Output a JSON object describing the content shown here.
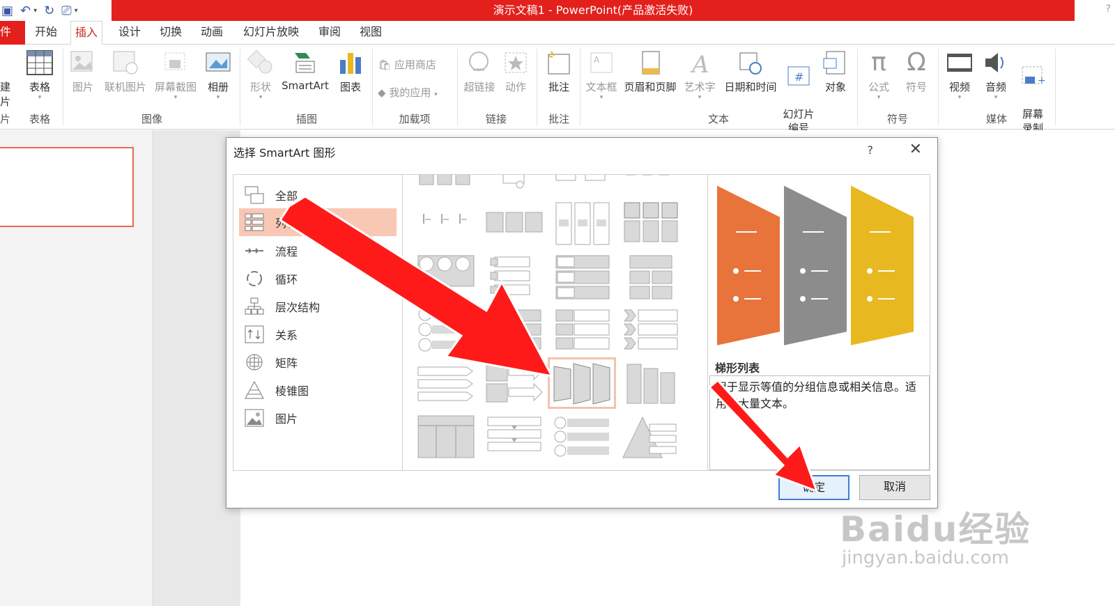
{
  "window": {
    "title": "演示文稿1 -  PowerPoint(产品激活失败)",
    "help": "?"
  },
  "tabs": [
    "件",
    "开始",
    "插入",
    "设计",
    "切换",
    "动画",
    "幻灯片放映",
    "审阅",
    "视图"
  ],
  "ribbon": {
    "partial_left": [
      "建",
      "片",
      "片"
    ],
    "table": {
      "label": "表格",
      "group": "表格"
    },
    "images": {
      "items": [
        "图片",
        "联机图片",
        "屏幕截图",
        "相册"
      ],
      "group": "图像"
    },
    "illustrations": {
      "items": [
        "形状",
        "SmartArt",
        "图表"
      ],
      "group": "插图"
    },
    "addins": {
      "items": [
        "应用商店",
        "我的应用"
      ],
      "group": "加载项"
    },
    "links": {
      "items": [
        "超链接",
        "动作"
      ],
      "group": "链接"
    },
    "comments": {
      "items": [
        "批注"
      ],
      "group": "批注"
    },
    "text": {
      "items": [
        "文本框",
        "页眉和页脚",
        "艺术字",
        "日期和时间",
        "幻灯片\n编号",
        "对象"
      ],
      "group": "文本"
    },
    "symbols": {
      "items": [
        "公式",
        "符号"
      ],
      "group": "符号"
    },
    "media": {
      "items": [
        "视频",
        "音频",
        "屏幕\n录制"
      ],
      "group": "媒体"
    }
  },
  "dialog": {
    "title": "选择 SmartArt 图形",
    "help": "?",
    "close": "✕",
    "categories": [
      "全部",
      "列表",
      "流程",
      "循环",
      "层次结构",
      "关系",
      "矩阵",
      "棱锥图",
      "图片"
    ],
    "selected_category": "列表",
    "preview": {
      "name": "梯形列表",
      "description": "用于显示等值的分组信息或相关信息。适用于大量文本。",
      "colors": [
        "#e8743b",
        "#8c8c8c",
        "#e8b820"
      ]
    },
    "ok": "确定",
    "cancel": "取消"
  },
  "watermark": {
    "main": "Baidu经验",
    "sub": "jingyan.baidu.com"
  }
}
